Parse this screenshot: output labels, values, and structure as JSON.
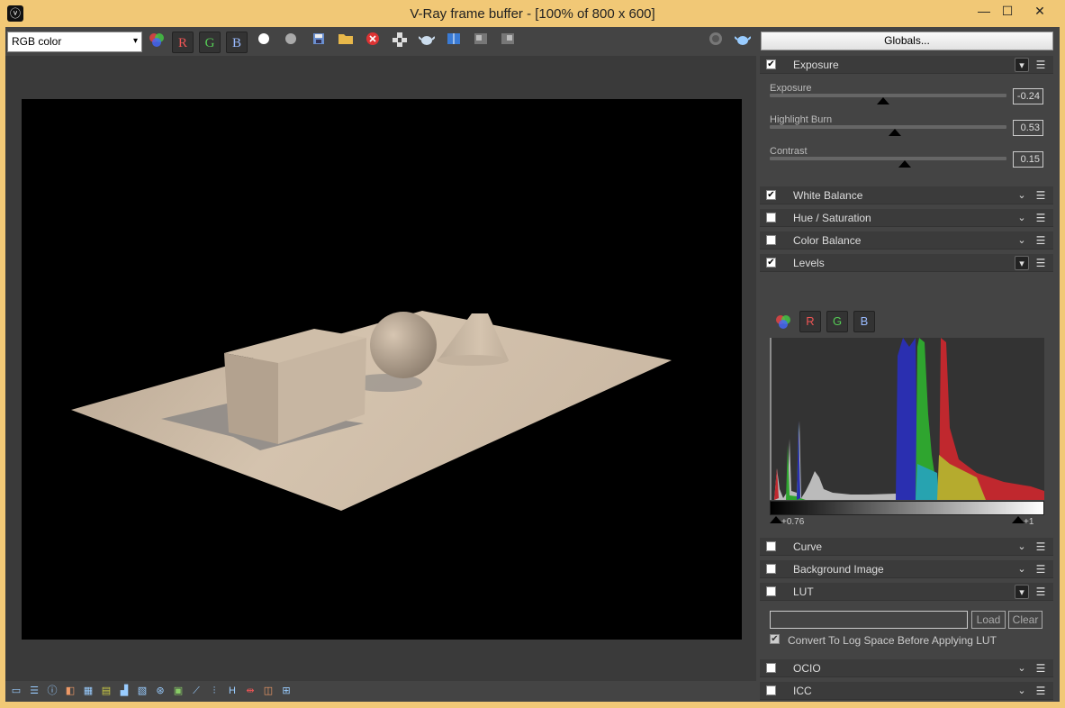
{
  "window": {
    "title": "V-Ray frame buffer - [100% of 800 x 600]",
    "app_icon": "v-ray-logo-icon"
  },
  "toolbar": {
    "channel": "RGB color",
    "r_label": "R",
    "g_label": "G",
    "b_label": "B",
    "globals_label": "Globals..."
  },
  "panel": {
    "exposure": {
      "header": "Exposure",
      "checked": true,
      "sliders": [
        {
          "label": "Exposure",
          "value": "-0.24",
          "pos": 0.48
        },
        {
          "label": "Highlight Burn",
          "value": "0.53",
          "pos": 0.53
        },
        {
          "label": "Contrast",
          "value": "0.15",
          "pos": 0.57
        }
      ]
    },
    "sections": [
      {
        "label": "White Balance",
        "checked": true
      },
      {
        "label": "Hue / Saturation",
        "checked": false
      },
      {
        "label": "Color Balance",
        "checked": false
      },
      {
        "label": "Levels",
        "checked": true
      }
    ],
    "levels": {
      "r_label": "R",
      "g_label": "G",
      "b_label": "B",
      "low_value": "+0.76",
      "high_value": "+1"
    },
    "sections2": [
      {
        "label": "Curve",
        "checked": false
      },
      {
        "label": "Background Image",
        "checked": false
      },
      {
        "label": "LUT",
        "checked": false
      }
    ],
    "lut": {
      "file": "",
      "load_label": "Load",
      "clear_label": "Clear",
      "log_label": "Convert To Log Space Before Applying LUT",
      "log_checked": true
    },
    "sections3": [
      {
        "label": "OCIO",
        "checked": false
      },
      {
        "label": "ICC",
        "checked": false
      }
    ]
  },
  "colors": {
    "frame": "#f1c876",
    "panel_bg": "#444444",
    "floor": "#cdbba6",
    "hist_red": "#c0282e",
    "hist_green": "#2fa52f",
    "hist_blue": "#2a2fb0"
  }
}
